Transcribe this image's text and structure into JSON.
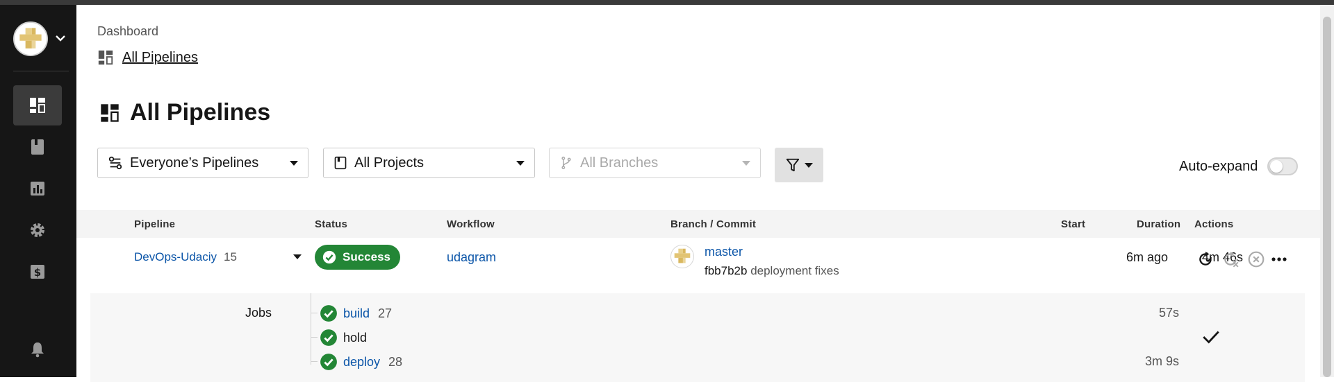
{
  "breadcrumb": {
    "root": "Dashboard",
    "current": "All Pipelines"
  },
  "page_title": "All Pipelines",
  "filters": {
    "pipelines_scope": "Everyone’s Pipelines",
    "project": "All Projects",
    "branch_placeholder": "All Branches"
  },
  "auto_expand": {
    "label": "Auto-expand",
    "enabled": false
  },
  "sidebar": {
    "items": [
      {
        "icon": "dashboard-icon",
        "active": true
      },
      {
        "icon": "projects-icon",
        "active": false
      },
      {
        "icon": "insights-icon",
        "active": false
      },
      {
        "icon": "settings-icon",
        "active": false
      },
      {
        "icon": "plans-icon",
        "active": false
      },
      {
        "icon": "notifications-icon",
        "active": false
      }
    ]
  },
  "table": {
    "headers": {
      "pipeline": "Pipeline",
      "status": "Status",
      "workflow": "Workflow",
      "branch_commit": "Branch / Commit",
      "start": "Start",
      "duration": "Duration",
      "actions": "Actions"
    },
    "row": {
      "pipeline_name": "DevOps-Udaciy",
      "pipeline_number": "15",
      "status": "Success",
      "workflow": "udagram",
      "branch": "master",
      "commit_hash": "fbb7b2b",
      "commit_message": "deployment fixes",
      "start": "6m ago",
      "duration": "4m 46s"
    }
  },
  "jobs": {
    "label": "Jobs",
    "items": [
      {
        "name": "build",
        "number": "27",
        "duration": "57s"
      },
      {
        "name": "hold",
        "number": "",
        "duration": ""
      },
      {
        "name": "deploy",
        "number": "28",
        "duration": "3m 9s"
      }
    ]
  },
  "colors": {
    "success": "#238636",
    "link": "#0b55a8",
    "sidebar": "#161616"
  }
}
